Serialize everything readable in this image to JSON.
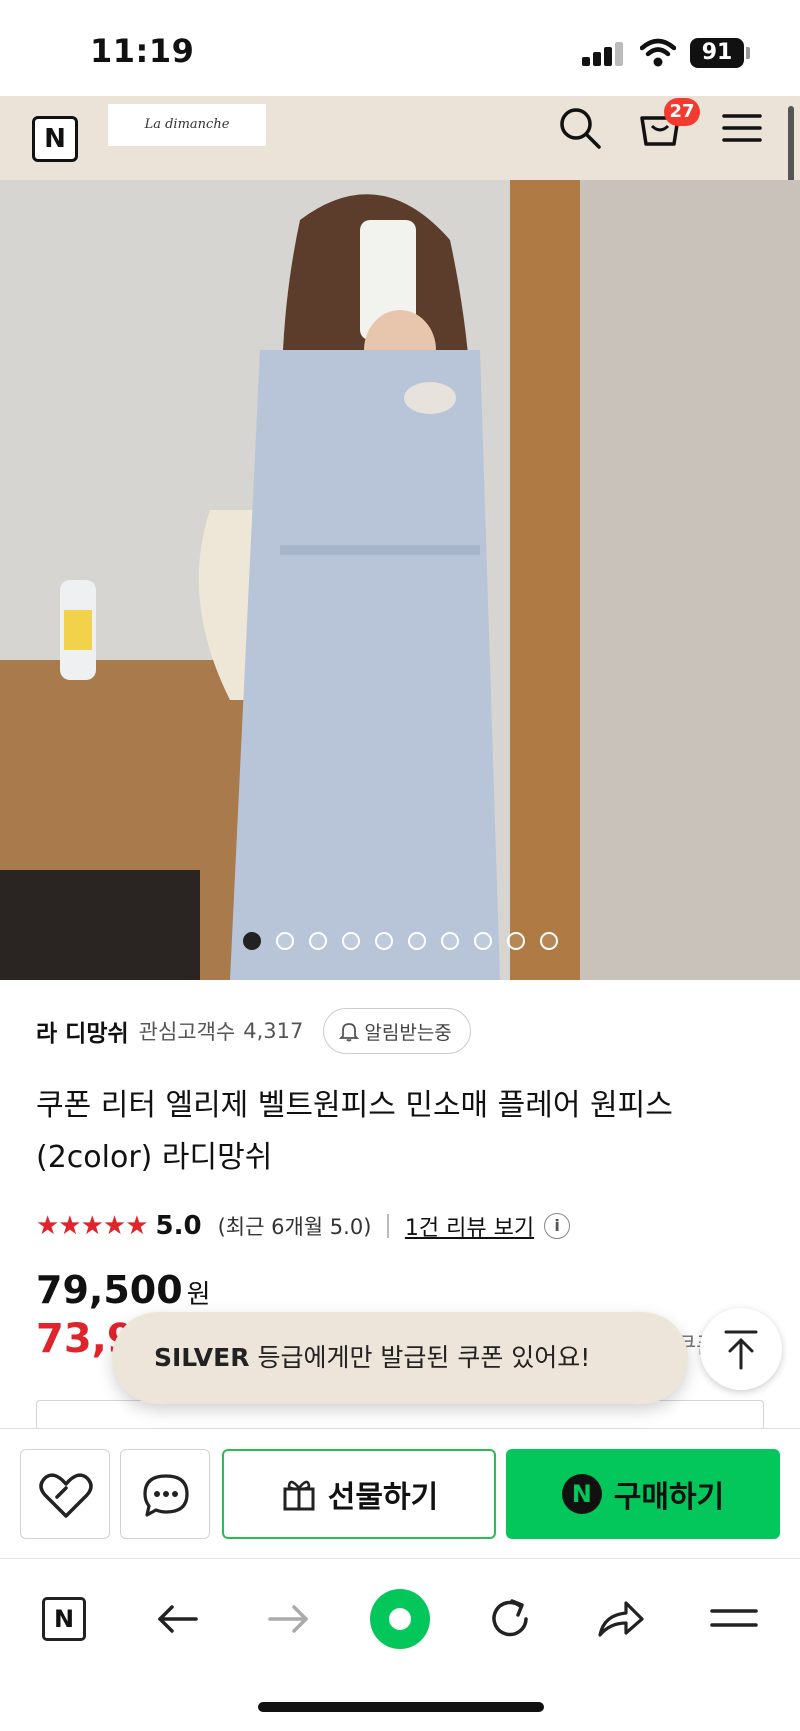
{
  "status_bar": {
    "time": "11:19",
    "battery": "91"
  },
  "header": {
    "logo": "N",
    "brand": "La dimanche",
    "cart_count": "27"
  },
  "gallery": {
    "total_images": 10,
    "active_index": 0
  },
  "product": {
    "seller": "라 디망쉬",
    "follower_label": "관심고객수",
    "follower_count": "4,317",
    "notify_label": "알림받는중",
    "title": "쿠폰 리터 엘리제 벨트원피스 민소매 플레어 원피스 (2color) 라디망쉬",
    "stars": "★★★★★",
    "rating": "5.0",
    "recent_rating": "(최근 6개월 5.0)",
    "review_link": "1건 리뷰 보기",
    "info_icon": "i",
    "original_price": "79,500",
    "currency": "원",
    "sale_price_visible": "73,9",
    "side_text_visible": "쿠폰"
  },
  "coupon_toast": {
    "grade": "SILVER",
    "message": "등급에게만 발급된 쿠폰 있어요!"
  },
  "purchase_bar": {
    "gift_label": "선물하기",
    "buy_label": "구매하기",
    "buy_logo": "N"
  },
  "browser_bar": {
    "logo": "N"
  },
  "colors": {
    "accent_green": "#03c75a",
    "price_red": "#e0242b",
    "header_beige": "#ebe3d8",
    "badge_red": "#f23b2e"
  }
}
